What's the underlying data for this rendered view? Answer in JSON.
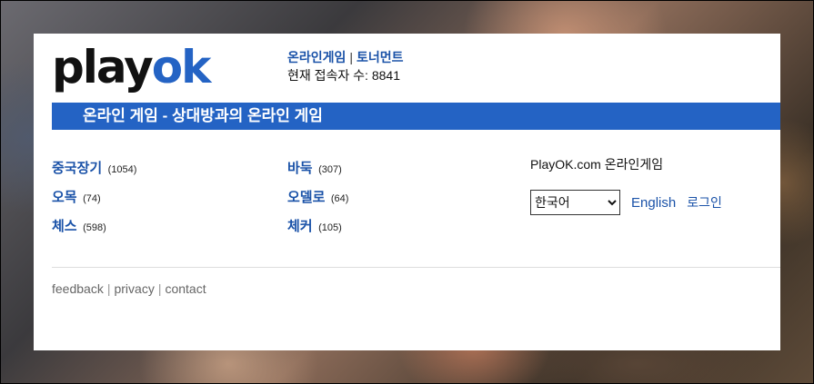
{
  "header": {
    "logo_play": "play",
    "logo_ok": "ok",
    "link_online": "온라인게임",
    "link_separator": "|",
    "link_tournament": "토너먼트",
    "online_users": "현재 접속자 수: 8841"
  },
  "banner": {
    "title": "온라인 게임 - 상대방과의 온라인 게임"
  },
  "games": {
    "col1": [
      {
        "name": "중국장기",
        "count": "(1054)"
      },
      {
        "name": "오목",
        "count": "(74)"
      },
      {
        "name": "체스",
        "count": "(598)"
      }
    ],
    "col2": [
      {
        "name": "바둑",
        "count": "(307)"
      },
      {
        "name": "오델로",
        "count": "(64)"
      },
      {
        "name": "체커",
        "count": "(105)"
      }
    ]
  },
  "side": {
    "site_title": "PlayOK.com 온라인게임",
    "language_selected": "한국어",
    "english_link": "English",
    "login_link": "로그인"
  },
  "footer": {
    "feedback": "feedback",
    "privacy": "privacy",
    "contact": "contact",
    "separator": "|"
  },
  "colors": {
    "brand_blue": "#2463c4",
    "link_blue": "#1a52a8"
  }
}
